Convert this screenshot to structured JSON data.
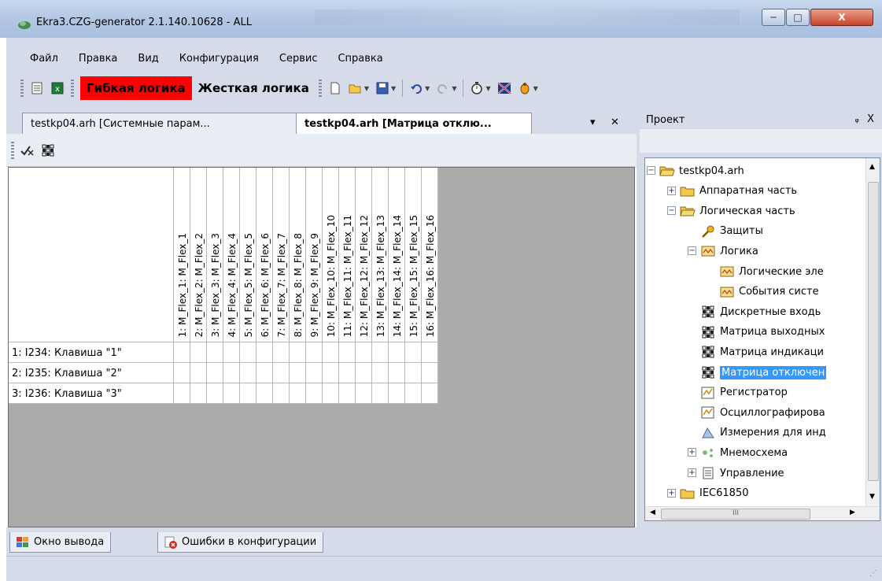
{
  "window": {
    "title": "Ekra3.CZG-generator 2.1.140.10628 - ALL",
    "minimize": "─",
    "maximize": "□",
    "close": "X"
  },
  "menu": [
    "Файл",
    "Правка",
    "Вид",
    "Конфигурация",
    "Сервис",
    "Справка"
  ],
  "toolbar": {
    "flex_logic": "Гибкая логика",
    "hard_logic": "Жесткая логика"
  },
  "tabs": [
    {
      "label": "testkp04.arh [Системные парам...",
      "active": false
    },
    {
      "label": "testkp04.arh [Матрица отклю...",
      "active": true
    }
  ],
  "tab_controls": {
    "dropdown": "▾",
    "close": "✕"
  },
  "matrix": {
    "columns": [
      "1: M_Flex_1: M_Flex_1",
      "2: M_Flex_2: M_Flex_2",
      "3: M_Flex_3: M_Flex_3",
      "4: M_Flex_4: M_Flex_4",
      "5: M_Flex_5: M_Flex_5",
      "6: M_Flex_6: M_Flex_6",
      "7: M_Flex_7: M_Flex_7",
      "8: M_Flex_8: M_Flex_8",
      "9: M_Flex_9: M_Flex_9",
      "10: M_Flex_10: M_Flex_10",
      "11: M_Flex_11: M_Flex_11",
      "12: M_Flex_12: M_Flex_12",
      "13: M_Flex_13: M_Flex_13",
      "14: M_Flex_14: M_Flex_14",
      "15: M_Flex_15: M_Flex_15",
      "16: M_Flex_16: M_Flex_16"
    ],
    "rows": [
      "1: I234:  Клавиша \"1\"",
      "2: I235:  Клавиша \"2\"",
      "3: I236:  Клавиша \"3\""
    ]
  },
  "project_panel": {
    "title": "Проект",
    "pin": "ᵩ",
    "close": "X",
    "tree": [
      {
        "label": "testkp04.arh",
        "level": 0,
        "icon": "folder-open-icon",
        "exp": "−"
      },
      {
        "label": "Аппаратная часть",
        "level": 1,
        "icon": "folder-icon",
        "exp": "+"
      },
      {
        "label": "Логическая часть",
        "level": 1,
        "icon": "folder-open-icon",
        "exp": "−"
      },
      {
        "label": "Защиты",
        "level": 2,
        "icon": "key-icon",
        "exp": ""
      },
      {
        "label": "Логика",
        "level": 2,
        "icon": "logic-icon",
        "exp": "−"
      },
      {
        "label": "Логические эле",
        "level": 3,
        "icon": "logic-icon",
        "exp": ""
      },
      {
        "label": "События систе",
        "level": 3,
        "icon": "logic-icon",
        "exp": ""
      },
      {
        "label": "Дискретные входь",
        "level": 2,
        "icon": "matrix-icon",
        "exp": ""
      },
      {
        "label": "Матрица выходных",
        "level": 2,
        "icon": "matrix-icon",
        "exp": ""
      },
      {
        "label": "Матрица индикаци",
        "level": 2,
        "icon": "matrix-icon",
        "exp": ""
      },
      {
        "label": "Матрица отключен",
        "level": 2,
        "icon": "matrix-icon",
        "exp": "",
        "selected": true
      },
      {
        "label": "Регистратор",
        "level": 2,
        "icon": "recorder-icon",
        "exp": ""
      },
      {
        "label": "Осциллографирова",
        "level": 2,
        "icon": "recorder-icon",
        "exp": ""
      },
      {
        "label": "Измерения для инд",
        "level": 2,
        "icon": "measurement-icon",
        "exp": ""
      },
      {
        "label": "Мнемосхема",
        "level": 2,
        "icon": "diagram-icon",
        "exp": "+"
      },
      {
        "label": "Управление",
        "level": 2,
        "icon": "document-icon",
        "exp": "+"
      },
      {
        "label": "IEC61850",
        "level": 1,
        "icon": "folder-icon",
        "exp": "+"
      }
    ],
    "hscroll_thumb": "III"
  },
  "bottom_tabs": [
    "Окно вывода",
    "Ошибки в конфигурации"
  ]
}
